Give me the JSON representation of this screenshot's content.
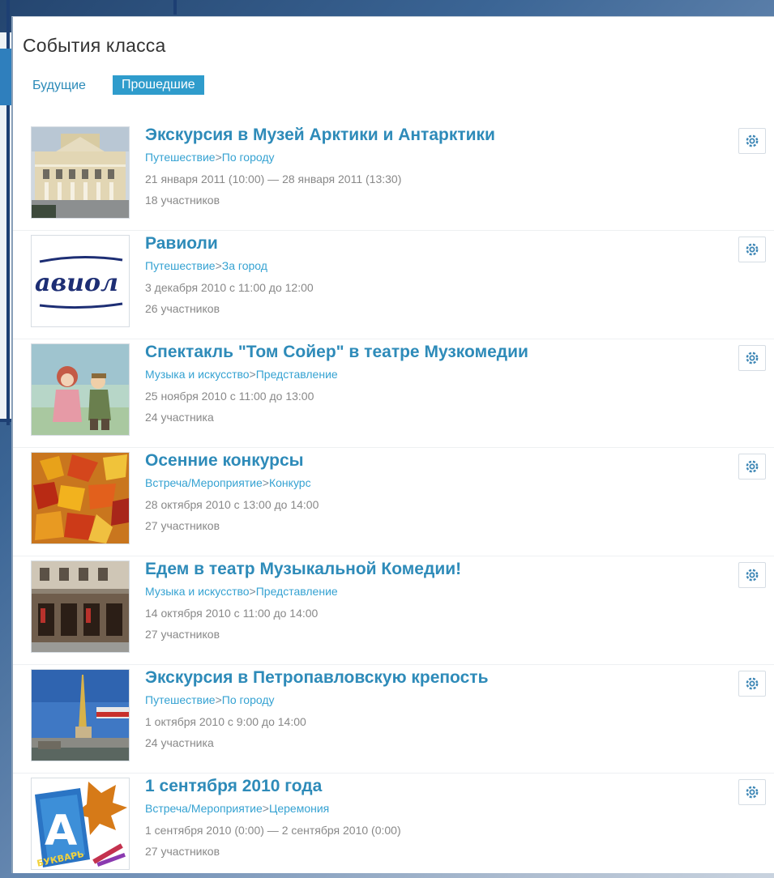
{
  "panel": {
    "title": "События класса",
    "tabs": {
      "future": "Будущие",
      "past": "Прошедшие"
    }
  },
  "events": [
    {
      "title": "Экскурсия в Музей Арктики и Антарктики",
      "category": "Путешествие",
      "subcategory": "По городу",
      "dates": "21 января 2011 (10:00) — 28 января 2011 (13:30)",
      "participants": "18 участников"
    },
    {
      "title": "Равиоли",
      "category": "Путешествие",
      "subcategory": "За город",
      "dates": "3 декабря 2010 с 11:00 до 12:00",
      "participants": "26 участников"
    },
    {
      "title": "Спектакль \"Том Сойер\" в театре Музкомедии",
      "category": "Музыка и искусство",
      "subcategory": "Представление",
      "dates": "25 ноября 2010 с 11:00 до 13:00",
      "participants": "24 участника"
    },
    {
      "title": "Осенние конкурсы",
      "category": "Встреча/Мероприятие",
      "subcategory": "Конкурс",
      "dates": "28 октября 2010 с 13:00 до 14:00",
      "participants": "27 участников"
    },
    {
      "title": "Едем в театр Музыкальной Комедии!",
      "category": "Музыка и искусство",
      "subcategory": "Представление",
      "dates": "14 октября 2010 с 11:00 до 14:00",
      "participants": "27 участников"
    },
    {
      "title": "Экскурсия в Петропавловскую крепость",
      "category": "Путешествие",
      "subcategory": "По городу",
      "dates": "1 октября 2010 с 9:00 до 14:00",
      "participants": "24 участника"
    },
    {
      "title": "1 сентября 2010 года",
      "category": "Встреча/Мероприятие",
      "subcategory": "Церемония",
      "dates": "1 сентября 2010 (0:00) — 2 сентября 2010 (0:00)",
      "participants": "27 участников"
    }
  ],
  "thumb_texts": {
    "ravioli_logo": "авиол",
    "bukvar": "БУКВАРЬ",
    "letter": "А"
  },
  "colors": {
    "accent": "#2e8bb9",
    "tab_active": "#2f9ccc",
    "link": "#35a2d2",
    "meta": "#888888"
  },
  "icons": {
    "settings": "gear-icon"
  }
}
